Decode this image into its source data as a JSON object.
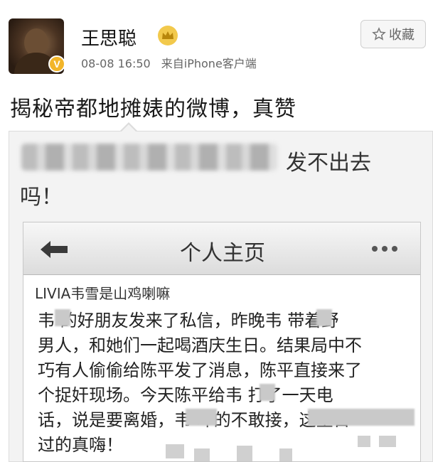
{
  "post": {
    "username": "王思聪",
    "time": "08-08 16:50",
    "source": "来自iPhone客户端",
    "verified_badge": "V",
    "favorite_label": "收藏",
    "text": "揭秘帝都地摊婊的微博，真赞"
  },
  "repost": {
    "text_line1": "发不出去",
    "text_line2": "吗！"
  },
  "embedded": {
    "nav_title": "个人主页",
    "username": "LIVIA韦雪是山鸡喇嘛",
    "lines": [
      "韦 的好朋友发来了私信，昨晚韦 带着野",
      "男人，和她们一起喝酒庆生日。结果局中不",
      "巧有人偷偷给陈平发了消息，陈平直接来了",
      "个捉奸现场。今天陈平给韦 打了一天电",
      "话，说是要离婚，韦 吓的不敢接，这生日",
      "过的真嗨！"
    ]
  },
  "icons": {
    "avatar": "user-avatar",
    "crown": "crown-icon",
    "star": "star-icon",
    "back": "back-arrow-icon",
    "more": "more-dots-icon"
  },
  "colors": {
    "badge": "#f2b529",
    "crown": "#f2c94c",
    "navbar": "#dcdcdc"
  }
}
